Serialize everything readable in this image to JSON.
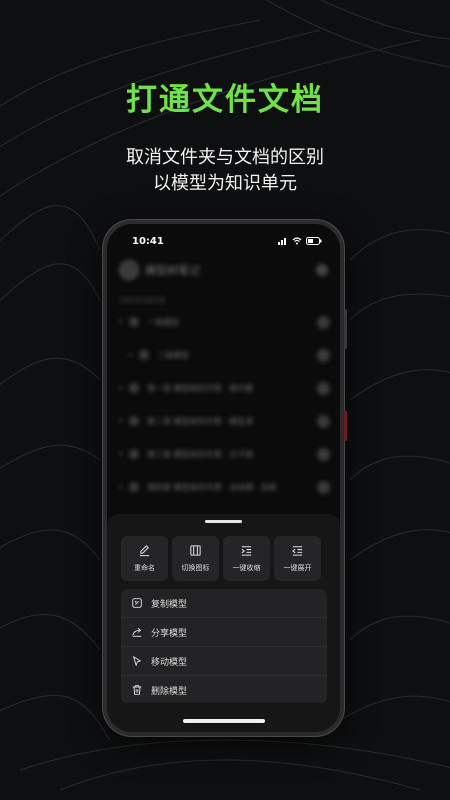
{
  "headline": "打通文件文档",
  "subtitle": {
    "line1": "取消文件夹与文档的区别",
    "line2": "以模型为知识单元"
  },
  "phone": {
    "status": {
      "time": "10:41"
    },
    "app": {
      "title": "模型树笔记",
      "date": "2023/10/10",
      "items": [
        {
          "level": 1,
          "label": "一级模型"
        },
        {
          "level": 2,
          "label": "二级模型"
        },
        {
          "level": 1,
          "label": "第一章 模型树的作用 · 替代模"
        },
        {
          "level": 1,
          "label": "第二章 模型树的作用 · 模型递"
        },
        {
          "level": 1,
          "label": "第三章 模型树的作用 · 分子链"
        },
        {
          "level": 1,
          "label": "第四章 模型树的作用 · 全体模 · 层级"
        }
      ]
    },
    "sheet": {
      "actions": [
        {
          "label": "重命名",
          "icon": "edit-icon"
        },
        {
          "label": "切换图标",
          "icon": "switch-icon"
        },
        {
          "label": "一键收缩",
          "icon": "collapse-icon"
        },
        {
          "label": "一键展开",
          "icon": "expand-icon"
        }
      ],
      "menu": [
        {
          "label": "复制模型",
          "icon": "copy-icon"
        },
        {
          "label": "分享模型",
          "icon": "share-icon"
        },
        {
          "label": "移动模型",
          "icon": "move-icon"
        },
        {
          "label": "删除模型",
          "icon": "trash-icon"
        }
      ]
    }
  },
  "colors": {
    "accent": "#6fe24a",
    "background": "#0e0f10"
  }
}
